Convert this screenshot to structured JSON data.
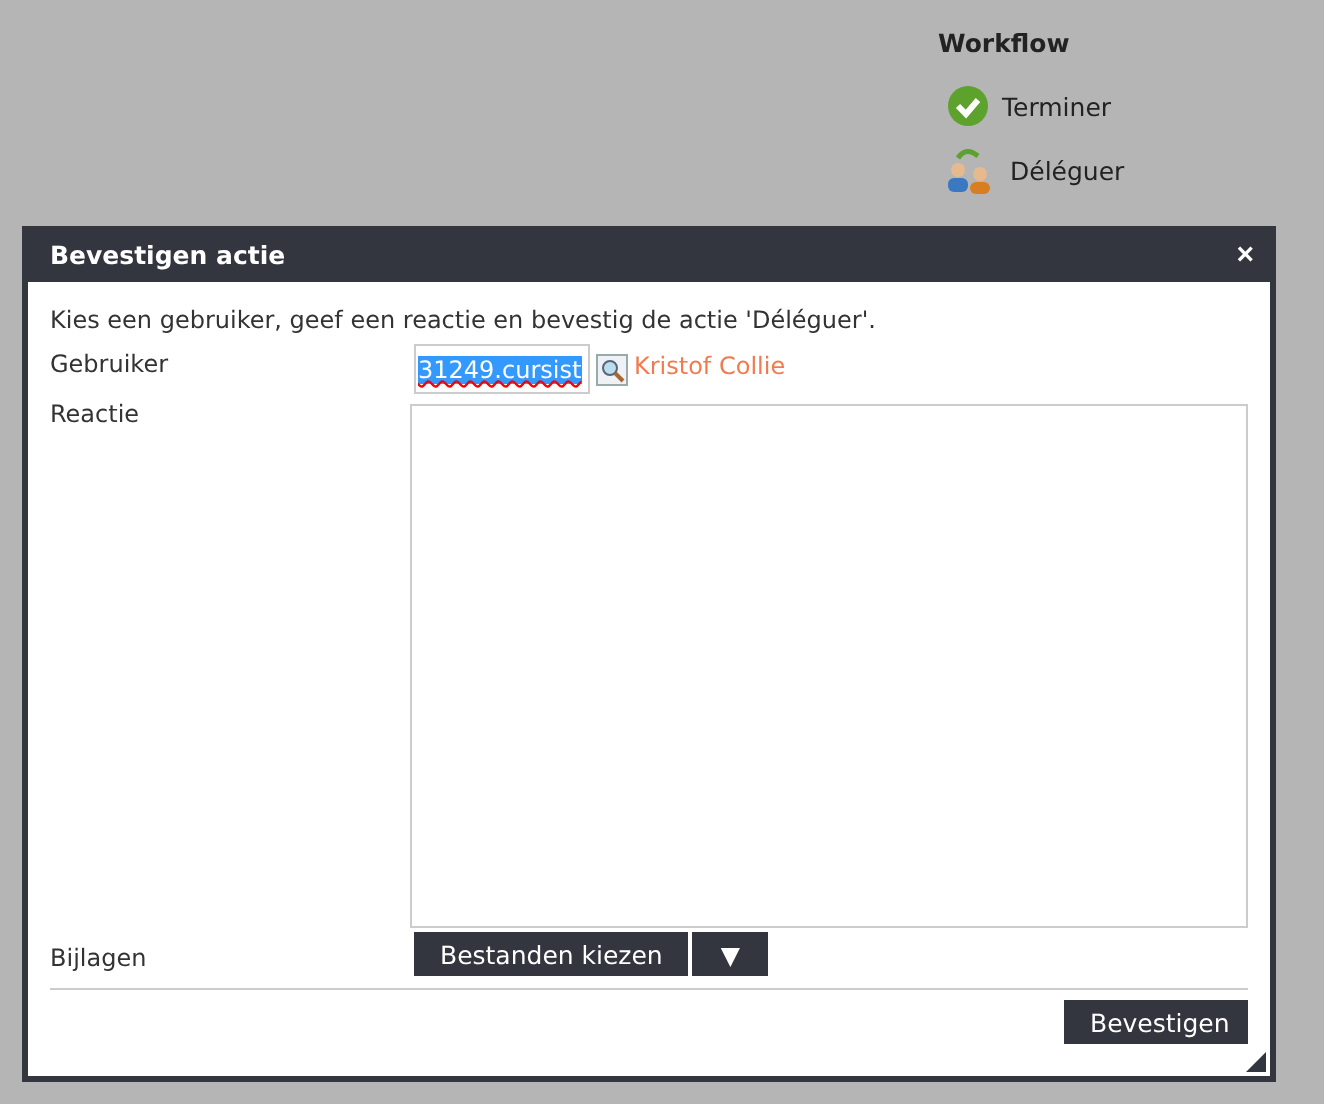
{
  "workflow": {
    "title": "Workflow",
    "actions": [
      {
        "kind": "finish",
        "label": "Terminer"
      },
      {
        "kind": "delegate",
        "label": "Déléguer"
      }
    ]
  },
  "dialog": {
    "title": "Bevestigen actie",
    "close": "×",
    "instruction": "Kies een gebruiker, geef een reactie en bevestig de actie 'Déléguer'.",
    "user": {
      "label": "Gebruiker",
      "value": "31249.cursist",
      "value_highlighted": true,
      "name": "Kristof Collie"
    },
    "reaction": {
      "label": "Reactie"
    },
    "attachments": {
      "label": "Bijlagen",
      "button": "Bestanden kiezen",
      "dropdown": "▼"
    },
    "confirm": "Bevestigen"
  }
}
